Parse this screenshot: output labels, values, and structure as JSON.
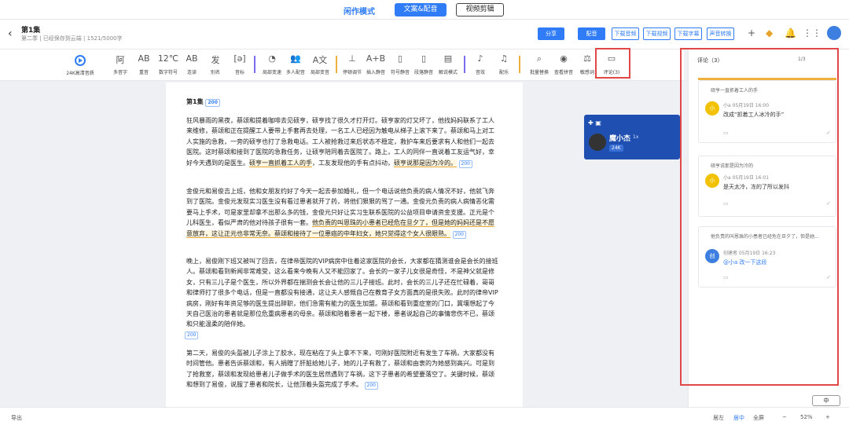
{
  "topbar": {
    "mode": "闲作模式",
    "wenan_btn": "文案&配音",
    "video_btn": "视频剪辑"
  },
  "header": {
    "title": "第1集",
    "meta": "第二季 | 已经保存到云端 | 1521/5000字",
    "share": "分享",
    "dub": "配音",
    "download_audio": "下载音频",
    "download_video": "下载视频",
    "download_subtitle": "下载字幕",
    "convert": "声音转换"
  },
  "toolbar": {
    "items": [
      "24K高清音质",
      "多音字",
      "重音",
      "数字符号",
      "连读",
      "别名",
      "音标",
      "局部变速",
      "多人配音",
      "局部变音",
      "停顿调节",
      "插入静音",
      "符号静音",
      "段落静音",
      "解说模式",
      "音效",
      "配乐",
      "批量替换",
      "查看拼音",
      "敏感词",
      "评论(3)"
    ]
  },
  "doc": {
    "heading": "第1集",
    "tag": "200",
    "p1a": "狂风暴雨的黑夜，蔡颂和提着咖啡去见硕亨，硕亨找了很久才打开灯。硕亨家的灯又坏了，他找妈妈联系了工人来维修，蔡颂和正在提醒工人要带上手套再去处理，一名工人已经因为触电从梯子上滚下来了。蔡颂和马上对工人实施的急救，一旁的硕亨也打了急救电话。工人被抢救过来后状态不稳定，救护车来后要求有人和他们一起去医院。这时蔡颂和接到了医院的急救任务，让硕亨陪同着去医院了。路上，工人的同伴一直说着工友运气好，幸好今天遇到的是医生。",
    "p1hl": "硕亨一直抓着工人的手",
    "p1b": "，工友发现他的手有点抖动，",
    "p1hl2": "硕亨说那是因为冷的。",
    "p2a": "金俊元和易俊吉上班，他和女朋友约好了今天一起去参加婚礼，但一个电话说他负责的病人情况不好，他就飞奔到了医院。金俊元发现实习医生没有看过患者就开了药，将他们狠狠的骂了一通。金俊元负责的病人病情恶化需要马上手术，可是家里却拿不出那么多的钱，金俊元只好让实习生联系医院的公益项目申请资金支援。正元是个儿科医生，看似严肃的他对待孩子很有一套。",
    "p2hl": "他负责的叫恩珠的小患者已经危在旦夕了，但是她的妈妈还是不愿意放弃，这让正元也非常无奈。",
    "p2hl2": "蔡颂和接待了一位患癌的中年妇女，她只觉得这个女人很眼熟。",
    "p3": "晚上，易俊刚下班又被叫了回去，在律帝医院的VIP病房中住着这家医院的会长，大家都在猜测谁会是会长的接班人。蔡颂和看到新闻非常难受，这么看来今晚有人又不能回家了。会长的一家子儿女很是奇怪，不是神父就是修女，只有三儿子是个医生，所以外界都在揣测会长会让他的三儿子接班。此时，会长的三儿子还在忙碌着，哥哥和律师打了很多个电话，但是一直都没有接通，这让夫人感慨自己在教育子女方面真的是很失败。此时的律帝VIP病房，刚好有年资足够的医生提出辞职，他们急需有能力的医生加盟。蔡颂和看到重症室的门口，冀壤想起了今天自己医治的患者就是那位危重病患者的母亲。蔡颂和陪着患者一起下楼，患者说起自己的事情悲伤不已，蔡颂和只能温柔的陪伴她。",
    "p4": "第二天，易俊的头盔被儿子涂上了胶水，现在粘在了头上拿不下来，可刚好医院附近有发生了车祸，大家都没有时间管他。患者告诉蔡颂和，有人捐赠了肝脏给她儿子，她的儿子有救了，蔡颂和由衷的为她感到高兴。可是到了抢救室，蔡颂和发现给患者儿子做手术的医生居然遇到了车祸，这下子患者的希望要落空了。关键时候，蔡颂和想到了易俊，说服了患者和院长，让他顶着头盔完成了手术。"
  },
  "float": {
    "name": "魔小杰",
    "speed": "1x",
    "quality": "24K"
  },
  "panel": {
    "title": "评论（3）",
    "page": "1/3",
    "cards": [
      {
        "quote": "硕亨一直抓着工人的手",
        "avatar": "小",
        "user": "小a  05月19日 16:00",
        "text": "改成“抓着工人冰冷的手”"
      },
      {
        "quote": "硕亨说那是因为冷的",
        "avatar": "小",
        "user": "小a  05月19日 16:01",
        "text": "是天太冷，冻的了所以发抖"
      },
      {
        "quote": "他负责的叫恩珠的小患者已经危在旦夕了，但是她...",
        "avatar": "创",
        "user": "创建者  05月19日 16:23",
        "text": "@小a  改一下这段"
      }
    ]
  },
  "bottom": {
    "left": "导出",
    "b1": "居左",
    "b2": "居中",
    "b3": "全屏",
    "zoom": "52%",
    "lang": "中"
  },
  "colors": {
    "accent": "#2f7cf6",
    "highlight": "#e6a93a",
    "annotation": "#e04848"
  }
}
